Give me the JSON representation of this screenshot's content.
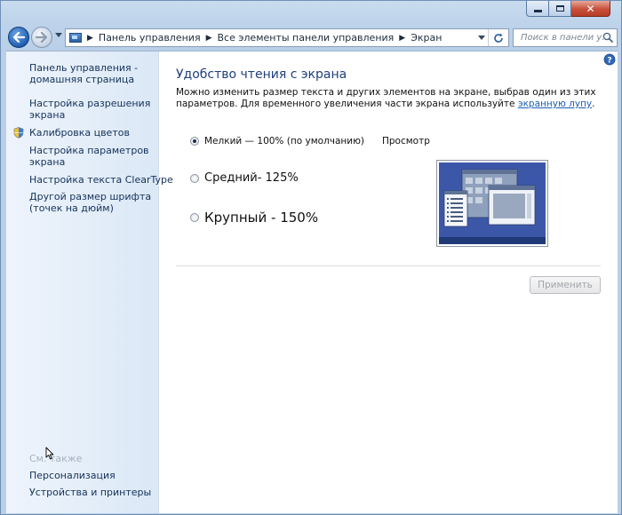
{
  "window": {
    "caption": {
      "minimize": "minimize",
      "maximize": "maximize",
      "close": "✕"
    }
  },
  "nav": {
    "breadcrumbs": [
      "Панель управления",
      "Все элементы панели управления",
      "Экран"
    ],
    "search_placeholder": "Поиск в панели у..."
  },
  "sidebar": {
    "items": [
      {
        "label_line1": "Панель управления -",
        "label_line2": "домашняя страница"
      },
      {
        "label_line1": "Настройка разрешения",
        "label_line2": "экрана"
      },
      {
        "label_line1": "Калибровка цветов",
        "label_line2": ""
      },
      {
        "label_line1": "Настройка параметров",
        "label_line2": "экрана"
      },
      {
        "label_line1": "Настройка текста ClearType",
        "label_line2": ""
      },
      {
        "label_line1": "Другой размер шрифта",
        "label_line2": "(точек на дюйм)"
      }
    ],
    "see_also": "См. также",
    "bottom_links": [
      "Персонализация",
      "Устройства и принтеры"
    ]
  },
  "main": {
    "title": "Удобство чтения с экрана",
    "description_part1": "Можно изменить размер текста и других элементов на экране, выбрав один из этих параметров. Для временного увеличения части экрана используйте ",
    "description_link": "экранную лупу",
    "description_end": ".",
    "options": [
      {
        "label": "Мелкий — 100% (по умолчанию)",
        "checked": true
      },
      {
        "label": "Средний- 125%",
        "checked": false
      },
      {
        "label": "Крупный - 150%",
        "checked": false
      }
    ],
    "preview_label": "Просмотр",
    "apply_label": "Применить"
  },
  "colors": {
    "title": "#1f3e7c",
    "link": "#1c5fb5",
    "preview_bg": "#3c57a8"
  }
}
